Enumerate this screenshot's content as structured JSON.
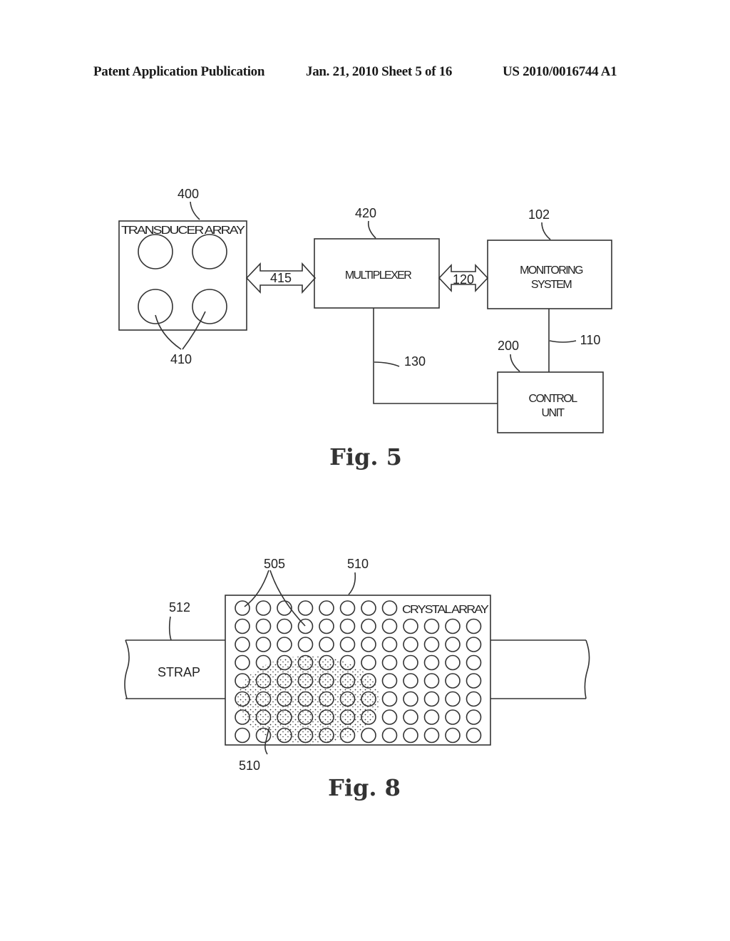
{
  "header": {
    "left": "Patent Application Publication",
    "middle": "Jan. 21, 2010  Sheet 5 of 16",
    "right": "US 2010/0016744 A1"
  },
  "fig5": {
    "caption": "Fig. 5",
    "transducer_array": {
      "ref": "400",
      "label": "TRANSDUCER ARRAY",
      "elements_ref": "410",
      "element_count": 4
    },
    "link_415": "415",
    "multiplexer": {
      "ref": "420",
      "label": "MULTIPLEXER"
    },
    "link_120": "120",
    "monitoring_system": {
      "ref": "102",
      "label_line1": "MONITORING",
      "label_line2": "SYSTEM"
    },
    "link_110": "110",
    "control_unit": {
      "ref": "200",
      "label_line1": "CONTROL",
      "label_line2": "UNIT"
    },
    "link_130": "130"
  },
  "fig8": {
    "caption": "Fig. 8",
    "crystal_array": {
      "ref": "510",
      "label": "CRYSTAL ARRAY",
      "rows": 8,
      "cols": 12
    },
    "crystals_ref": "505",
    "strap": {
      "ref": "512",
      "label": "STRAP"
    },
    "active_region_ref": "510"
  }
}
